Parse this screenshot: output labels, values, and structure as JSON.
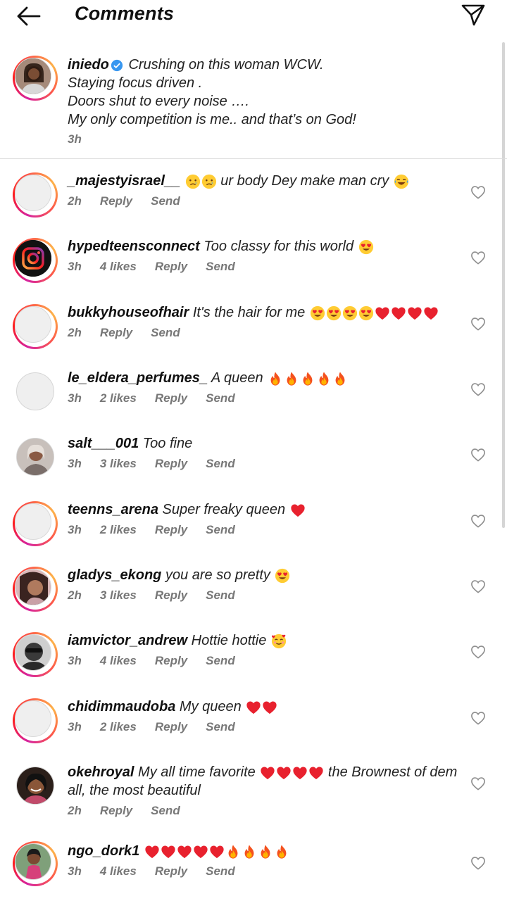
{
  "header": {
    "title": "Comments"
  },
  "post": {
    "username": "iniedo",
    "lines": [
      "Crushing on this woman WCW.",
      "Staying focus driven .",
      "Doors shut to every noise ….",
      "My only competition is me.. and that’s on God!"
    ],
    "time": "3h"
  },
  "actions": {
    "reply": "Reply",
    "send": "Send"
  },
  "comments": [
    {
      "user": "_majestyisrael__",
      "text": "ur body Dey make man cry",
      "time": "2h",
      "likes": ""
    },
    {
      "user": "hypedteensconnect",
      "text": "Too classy for this world",
      "time": "3h",
      "likes": "4 likes"
    },
    {
      "user": "bukkyhouseofhair",
      "text": "It's the hair for me",
      "time": "2h",
      "likes": ""
    },
    {
      "user": "le_eldera_perfumes_",
      "text": "A queen",
      "time": "3h",
      "likes": "2 likes"
    },
    {
      "user": "salt___001",
      "text": "Too fine",
      "time": "3h",
      "likes": "3 likes"
    },
    {
      "user": "teenns_arena",
      "text": "Super freaky queen",
      "time": "3h",
      "likes": "2 likes"
    },
    {
      "user": "gladys_ekong",
      "text": "you are so pretty",
      "time": "2h",
      "likes": "3 likes"
    },
    {
      "user": "iamvictor_andrew",
      "text": "Hottie hottie",
      "time": "3h",
      "likes": "4 likes"
    },
    {
      "user": "chidimmaudoba",
      "text": "My queen",
      "time": "3h",
      "likes": "2 likes"
    },
    {
      "user": "okehroyal",
      "text": "My all time favorite",
      "text2": "the Brownest of dem",
      "text3": "all, the most beautiful",
      "time": "2h",
      "likes": ""
    },
    {
      "user": "ngo_dork1",
      "text": "",
      "time": "3h",
      "likes": "4 likes"
    }
  ],
  "colors": {
    "accent_blue": "#3897f0",
    "heart_red": "#e8212e",
    "ring_start": "#d6249f",
    "ring_end": "#fdb34a"
  },
  "icons": [
    "back-arrow-icon",
    "send-paper-plane-icon",
    "verified-badge-icon",
    "heart-outline-icon",
    "instagram-logo-icon"
  ]
}
